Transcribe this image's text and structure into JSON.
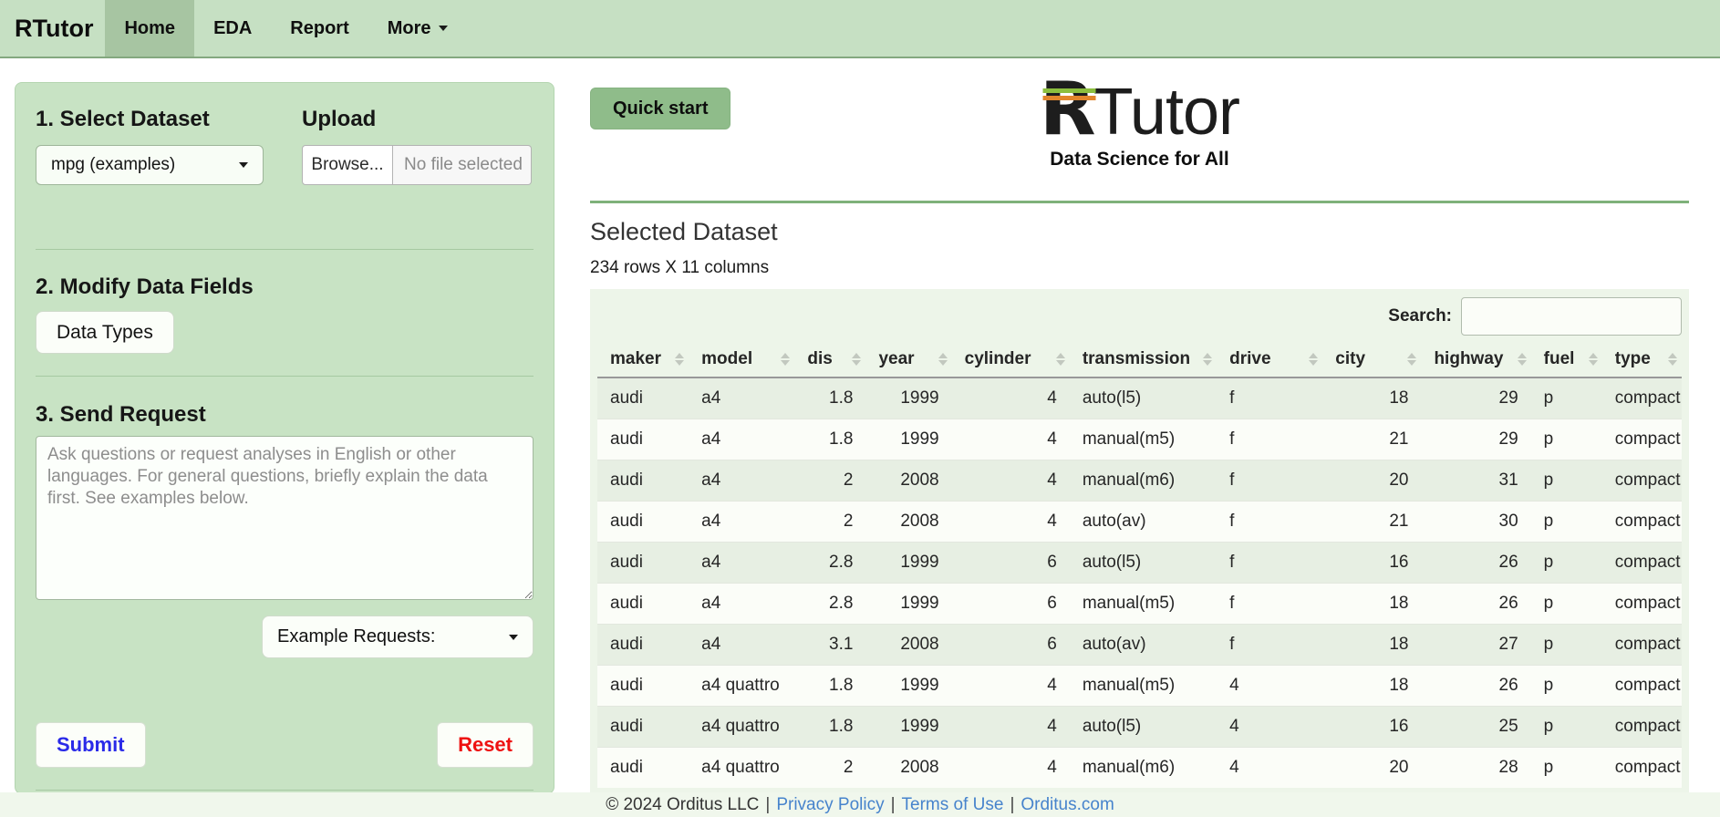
{
  "navbar": {
    "brand": "RTutor",
    "items": [
      {
        "label": "Home",
        "active": true,
        "dropdown": false
      },
      {
        "label": "EDA",
        "active": false,
        "dropdown": false
      },
      {
        "label": "Report",
        "active": false,
        "dropdown": false
      },
      {
        "label": "More",
        "active": false,
        "dropdown": true
      }
    ]
  },
  "sidebar": {
    "section1_title": "1. Select Dataset",
    "upload_label": "Upload",
    "dataset_select_value": "mpg (examples)",
    "browse_label": "Browse...",
    "file_status": "No file selected",
    "section2_title": "2. Modify Data Fields",
    "data_types_label": "Data Types",
    "section3_title": "3. Send Request",
    "request_placeholder": "Ask questions or request analyses in English or other languages. For general questions, briefly explain the data first. See examples below.",
    "example_requests_label": "Example Requests:",
    "submit_label": "Submit",
    "reset_label": "Reset"
  },
  "main": {
    "quick_start_label": "Quick start",
    "logo": {
      "r": "R",
      "rest": "Tutor",
      "tagline": "Data Science for All"
    },
    "dataset_title": "Selected Dataset",
    "dataset_dims": "234 rows X 11 columns",
    "search_label": "Search:",
    "search_value": "",
    "table": {
      "columns": [
        "maker",
        "model",
        "dis",
        "year",
        "cylinder",
        "transmission",
        "drive",
        "city",
        "highway",
        "fuel",
        "type"
      ],
      "rows": [
        [
          "audi",
          "a4",
          "1.8",
          "1999",
          "4",
          "auto(l5)",
          "f",
          "18",
          "29",
          "p",
          "compact"
        ],
        [
          "audi",
          "a4",
          "1.8",
          "1999",
          "4",
          "manual(m5)",
          "f",
          "21",
          "29",
          "p",
          "compact"
        ],
        [
          "audi",
          "a4",
          "2",
          "2008",
          "4",
          "manual(m6)",
          "f",
          "20",
          "31",
          "p",
          "compact"
        ],
        [
          "audi",
          "a4",
          "2",
          "2008",
          "4",
          "auto(av)",
          "f",
          "21",
          "30",
          "p",
          "compact"
        ],
        [
          "audi",
          "a4",
          "2.8",
          "1999",
          "6",
          "auto(l5)",
          "f",
          "16",
          "26",
          "p",
          "compact"
        ],
        [
          "audi",
          "a4",
          "2.8",
          "1999",
          "6",
          "manual(m5)",
          "f",
          "18",
          "26",
          "p",
          "compact"
        ],
        [
          "audi",
          "a4",
          "3.1",
          "2008",
          "6",
          "auto(av)",
          "f",
          "18",
          "27",
          "p",
          "compact"
        ],
        [
          "audi",
          "a4 quattro",
          "1.8",
          "1999",
          "4",
          "manual(m5)",
          "4",
          "18",
          "26",
          "p",
          "compact"
        ],
        [
          "audi",
          "a4 quattro",
          "1.8",
          "1999",
          "4",
          "auto(l5)",
          "4",
          "16",
          "25",
          "p",
          "compact"
        ],
        [
          "audi",
          "a4 quattro",
          "2",
          "2008",
          "4",
          "manual(m6)",
          "4",
          "20",
          "28",
          "p",
          "compact"
        ]
      ]
    }
  },
  "footer": {
    "copyright": "© 2024 Orditus LLC",
    "separator": "|",
    "links": [
      "Privacy Policy",
      "Terms of Use",
      "Orditus.com"
    ]
  },
  "colors": {
    "navbar_bg": "#c6e0c3",
    "navbar_active_bg": "#a7c5a2",
    "sidebar_bg": "#c8e3c4",
    "quick_start_bg": "#8fbc8a",
    "divider_green": "#7fb17a",
    "table_card_bg": "#edf5e9",
    "row_stripe": "#e7efe3",
    "logo_stripe_green": "#8cbf3e",
    "logo_stripe_orange": "#e2862c",
    "link_blue": "#4683cc",
    "submit_blue": "#2a2ae8",
    "reset_red": "#ee1111"
  }
}
